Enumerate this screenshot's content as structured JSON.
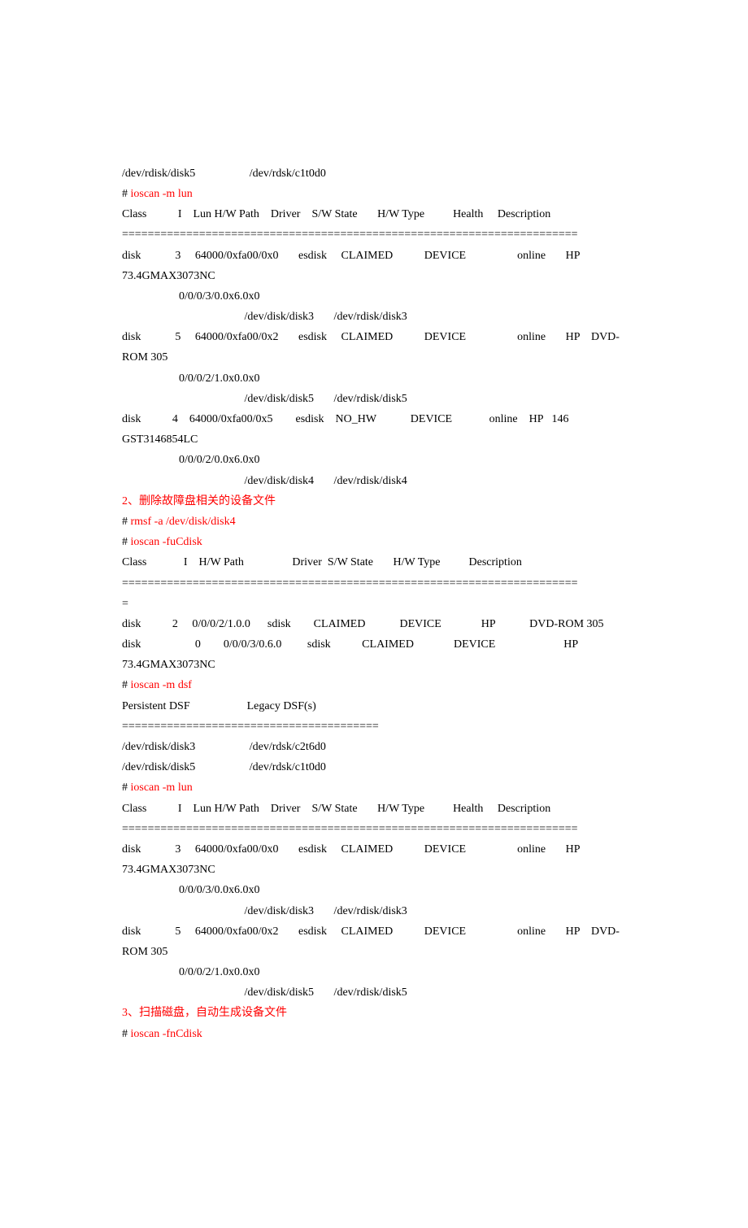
{
  "lines": [
    {
      "t": "/dev/rdisk/disk5                   /dev/rdsk/c1t0d0"
    },
    {
      "pre": "# ",
      "cmd": "ioscan -m lun"
    },
    {
      "t": "Class           I    Lun H/W Path    Driver    S/W State       H/W Type          Health     Description"
    },
    {
      "t": "======================================================================="
    },
    {
      "t": "disk            3     64000/0xfa00/0x0       esdisk     CLAIMED           DEVICE                  online       HP    73.4GMAX3073NC"
    },
    {
      "t": "                    0/0/0/3/0.0x6.0x0"
    },
    {
      "t": "                                           /dev/disk/disk3       /dev/rdisk/disk3"
    },
    {
      "t": "disk            5     64000/0xfa00/0x2       esdisk     CLAIMED           DEVICE                  online       HP    DVD-ROM 305"
    },
    {
      "t": "                    0/0/0/2/1.0x0.0x0"
    },
    {
      "t": "                                           /dev/disk/disk5       /dev/rdisk/disk5"
    },
    {
      "t": "disk           4    64000/0xfa00/0x5        esdisk    NO_HW            DEVICE             online    HP   146 GST3146854LC"
    },
    {
      "t": "                    0/0/0/2/0.0x6.0x0"
    },
    {
      "t": "                                           /dev/disk/disk4       /dev/rdisk/disk4"
    },
    {
      "heading": "2、删除故障盘相关的设备文件"
    },
    {
      "pre": "# ",
      "cmd": "rmsf -a /dev/disk/disk4"
    },
    {
      "pre": "# ",
      "cmd": "ioscan -fuCdisk"
    },
    {
      "t": "Class             I    H/W Path                 Driver  S/W State       H/W Type          Description"
    },
    {
      "t": "======================================================================="
    },
    {
      "t": "="
    },
    {
      "t": "disk           2     0/0/0/2/1.0.0      sdisk        CLAIMED            DEVICE              HP            DVD-ROM 305"
    },
    {
      "t": "disk                   0        0/0/0/3/0.6.0         sdisk           CLAIMED              DEVICE                        HP    73.4GMAX3073NC"
    },
    {
      "pre": "# ",
      "cmd": "ioscan -m dsf"
    },
    {
      "t": "Persistent DSF                    Legacy DSF(s)"
    },
    {
      "t": "========================================"
    },
    {
      "t": "/dev/rdisk/disk3                   /dev/rdsk/c2t6d0"
    },
    {
      "t": "/dev/rdisk/disk5                   /dev/rdsk/c1t0d0"
    },
    {
      "pre": "# ",
      "cmd": "ioscan -m lun"
    },
    {
      "t": "Class           I    Lun H/W Path    Driver    S/W State       H/W Type          Health     Description"
    },
    {
      "t": "======================================================================="
    },
    {
      "t": "disk            3     64000/0xfa00/0x0       esdisk     CLAIMED           DEVICE                  online       HP    73.4GMAX3073NC"
    },
    {
      "t": "                    0/0/0/3/0.0x6.0x0"
    },
    {
      "t": "                                           /dev/disk/disk3       /dev/rdisk/disk3"
    },
    {
      "t": "disk            5     64000/0xfa00/0x2       esdisk     CLAIMED           DEVICE                  online       HP    DVD-ROM 305"
    },
    {
      "t": "                    0/0/0/2/1.0x0.0x0"
    },
    {
      "t": "                                           /dev/disk/disk5       /dev/rdisk/disk5"
    },
    {
      "heading": "3、扫描磁盘，自动生成设备文件"
    },
    {
      "pre": "# ",
      "cmd": "ioscan -fnCdisk"
    }
  ]
}
